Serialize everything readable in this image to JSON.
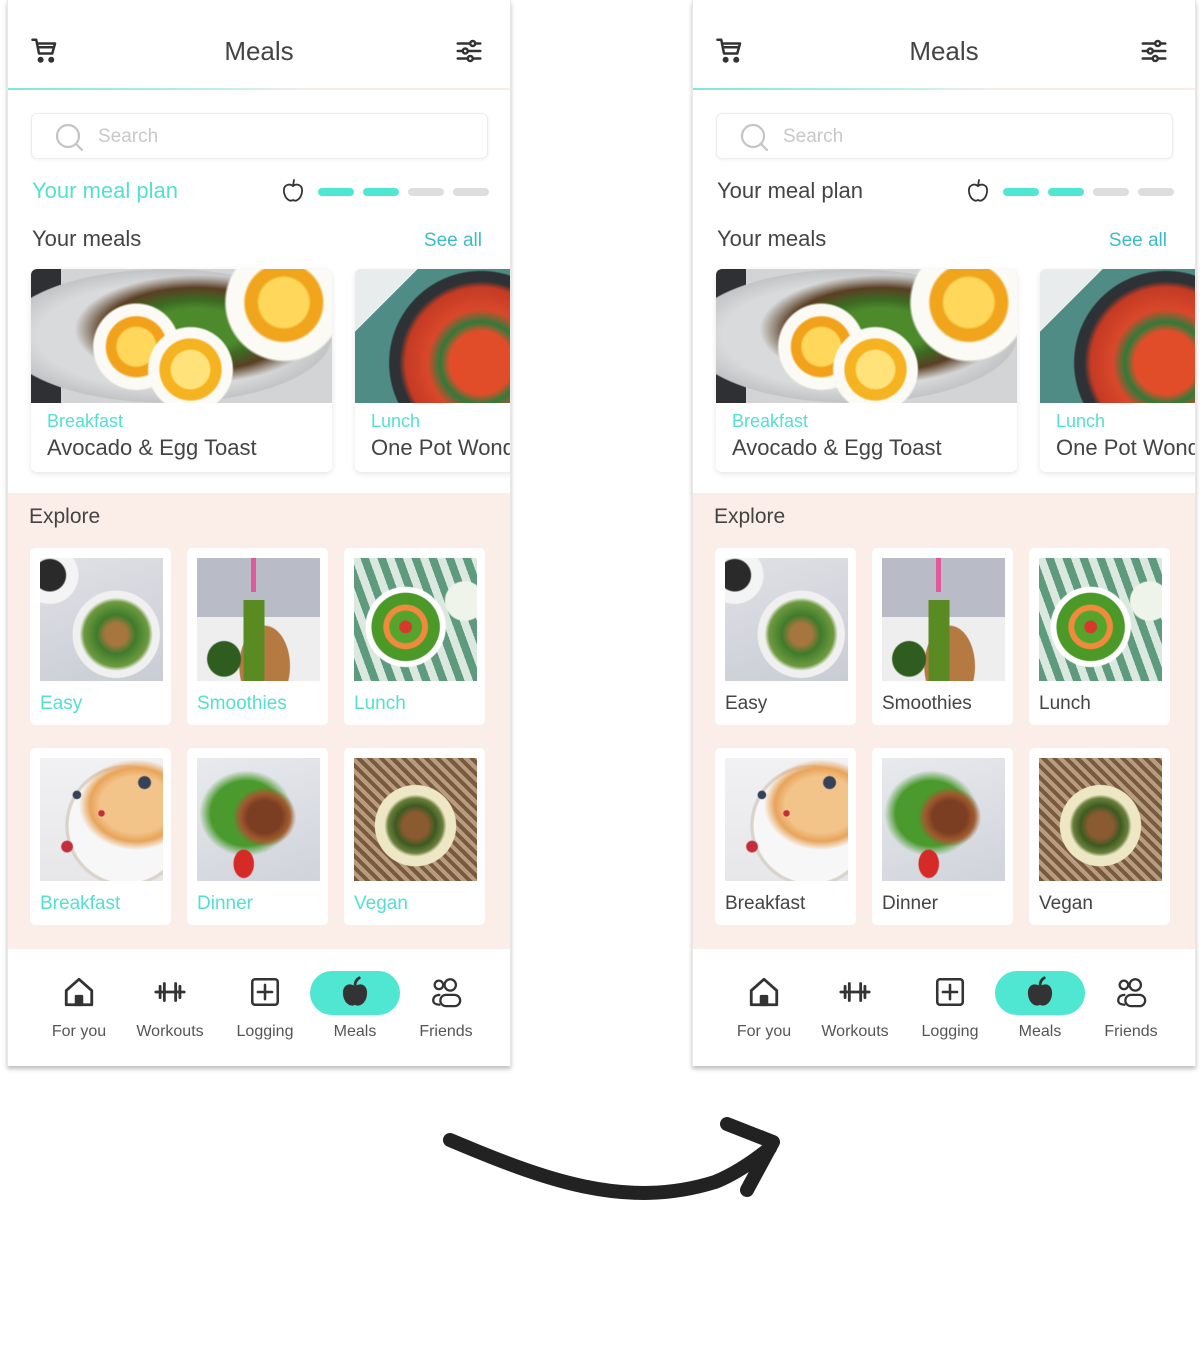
{
  "screens": [
    {
      "variant": "before",
      "header": {
        "title": "Meals",
        "left_icon": "cart-icon",
        "right_icon": "filter-sliders-icon"
      },
      "search": {
        "placeholder": "Search",
        "value": ""
      },
      "meal_plan": {
        "label": "Your meal plan",
        "label_color": "#53e0d0",
        "progress_steps_total": 4,
        "progress_steps_done": 2
      },
      "your_meals": {
        "label": "Your meals",
        "see_all": "See all",
        "cards": [
          {
            "category": "Breakfast",
            "name": "Avocado & Egg Toast"
          },
          {
            "category": "Lunch",
            "name": "One Pot Wond"
          }
        ]
      },
      "explore": {
        "title": "Explore",
        "label_color": "#53e0d0",
        "tiles": [
          {
            "label": "Easy"
          },
          {
            "label": "Smoothies"
          },
          {
            "label": "Lunch"
          },
          {
            "label": "Breakfast"
          },
          {
            "label": "Dinner"
          },
          {
            "label": "Vegan"
          }
        ]
      },
      "nav": {
        "active": "Meals",
        "items": [
          {
            "label": "For you",
            "icon": "home-icon"
          },
          {
            "label": "Workouts",
            "icon": "dumbbell-icon"
          },
          {
            "label": "Logging",
            "icon": "plus-square-icon"
          },
          {
            "label": "Meals",
            "icon": "apple-icon"
          },
          {
            "label": "Friends",
            "icon": "friends-icon"
          }
        ]
      }
    },
    {
      "variant": "after",
      "header": {
        "title": "Meals",
        "left_icon": "cart-icon",
        "right_icon": "filter-sliders-icon"
      },
      "search": {
        "placeholder": "Search",
        "value": ""
      },
      "meal_plan": {
        "label": "Your meal plan",
        "label_color": "#444444",
        "progress_steps_total": 4,
        "progress_steps_done": 2
      },
      "your_meals": {
        "label": "Your meals",
        "see_all": "See all",
        "cards": [
          {
            "category": "Breakfast",
            "name": "Avocado & Egg Toast"
          },
          {
            "category": "Lunch",
            "name": "One Pot Wond"
          }
        ]
      },
      "explore": {
        "title": "Explore",
        "label_color": "#444444",
        "tiles": [
          {
            "label": "Easy"
          },
          {
            "label": "Smoothies"
          },
          {
            "label": "Lunch"
          },
          {
            "label": "Breakfast"
          },
          {
            "label": "Dinner"
          },
          {
            "label": "Vegan"
          }
        ]
      },
      "nav": {
        "active": "Meals",
        "items": [
          {
            "label": "For you",
            "icon": "home-icon"
          },
          {
            "label": "Workouts",
            "icon": "dumbbell-icon"
          },
          {
            "label": "Logging",
            "icon": "plus-square-icon"
          },
          {
            "label": "Meals",
            "icon": "apple-icon"
          },
          {
            "label": "Friends",
            "icon": "friends-icon"
          }
        ]
      }
    }
  ],
  "colors": {
    "accent": "#4fe6d2",
    "accent_text": "#53e0d0",
    "link": "#3cbcc8",
    "explore_bg": "#fbede7",
    "text": "#444444"
  },
  "transition_arrow": {
    "icon": "curved-arrow-right-icon"
  }
}
